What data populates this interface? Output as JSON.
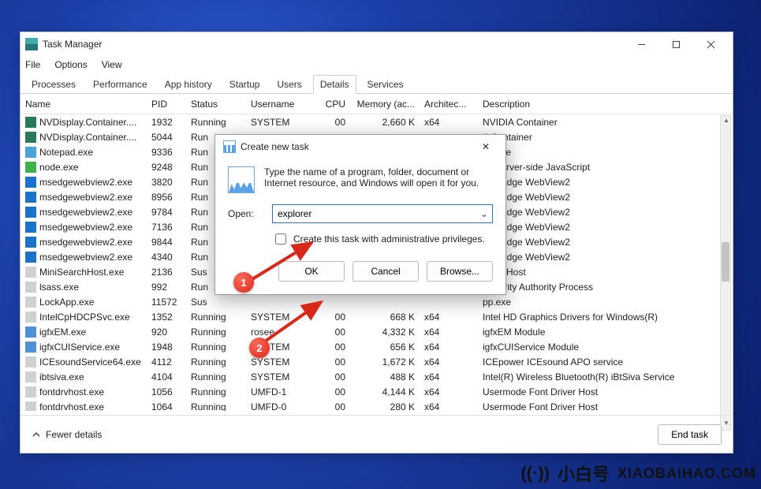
{
  "window": {
    "title": "Task Manager",
    "menus": [
      "File",
      "Options",
      "View"
    ],
    "tabs": [
      "Processes",
      "Performance",
      "App history",
      "Startup",
      "Users",
      "Details",
      "Services"
    ],
    "selected_tab": 5,
    "columns": [
      "Name",
      "PID",
      "Status",
      "Username",
      "CPU",
      "Memory (ac...",
      "Architec...",
      "Description"
    ],
    "fewer": "Fewer details",
    "end_task": "End task"
  },
  "rows": [
    {
      "ico": "#2a7a5a",
      "name": "NVDisplay.Container....",
      "pid": "1932",
      "status": "Running",
      "user": "SYSTEM",
      "cpu": "00",
      "mem": "2,660 K",
      "arch": "x64",
      "desc": "NVIDIA Container"
    },
    {
      "ico": "#2a7a5a",
      "name": "NVDisplay.Container....",
      "pid": "5044",
      "status": "Run",
      "user": "",
      "cpu": "",
      "mem": "",
      "arch": "",
      "desc": "A Container"
    },
    {
      "ico": "#4aa3d6",
      "name": "Notepad.exe",
      "pid": "9336",
      "status": "Run",
      "user": "",
      "cpu": "",
      "mem": "",
      "arch": "",
      "desc": "ad.exe"
    },
    {
      "ico": "#3cb24a",
      "name": "node.exe",
      "pid": "9248",
      "status": "Run",
      "user": "",
      "cpu": "",
      "mem": "",
      "arch": "",
      "desc": "js: Server-side JavaScript"
    },
    {
      "ico": "#1a73c9",
      "name": "msedgewebview2.exe",
      "pid": "3820",
      "status": "Run",
      "user": "",
      "cpu": "",
      "mem": "",
      "arch": "",
      "desc": "soft Edge WebView2"
    },
    {
      "ico": "#1a73c9",
      "name": "msedgewebview2.exe",
      "pid": "8956",
      "status": "Run",
      "user": "",
      "cpu": "",
      "mem": "",
      "arch": "",
      "desc": "soft Edge WebView2"
    },
    {
      "ico": "#1a73c9",
      "name": "msedgewebview2.exe",
      "pid": "9784",
      "status": "Run",
      "user": "",
      "cpu": "",
      "mem": "",
      "arch": "",
      "desc": "soft Edge WebView2"
    },
    {
      "ico": "#1a73c9",
      "name": "msedgewebview2.exe",
      "pid": "7136",
      "status": "Run",
      "user": "",
      "cpu": "",
      "mem": "",
      "arch": "",
      "desc": "soft Edge WebView2"
    },
    {
      "ico": "#1a73c9",
      "name": "msedgewebview2.exe",
      "pid": "9844",
      "status": "Run",
      "user": "",
      "cpu": "",
      "mem": "",
      "arch": "",
      "desc": "soft Edge WebView2"
    },
    {
      "ico": "#1a73c9",
      "name": "msedgewebview2.exe",
      "pid": "4340",
      "status": "Run",
      "user": "",
      "cpu": "",
      "mem": "",
      "arch": "",
      "desc": "soft Edge WebView2"
    },
    {
      "ico": "#d0d0d0",
      "name": "MiniSearchHost.exe",
      "pid": "2136",
      "status": "Sus",
      "user": "",
      "cpu": "",
      "mem": "",
      "arch": "",
      "desc": "earchHost"
    },
    {
      "ico": "#d0d0d0",
      "name": "lsass.exe",
      "pid": "992",
      "status": "Run",
      "user": "",
      "cpu": "",
      "mem": "",
      "arch": "",
      "desc": "Security Authority Process"
    },
    {
      "ico": "#d0d0d0",
      "name": "LockApp.exe",
      "pid": "11572",
      "status": "Sus",
      "user": "",
      "cpu": "",
      "mem": "",
      "arch": "",
      "desc": "pp.exe"
    },
    {
      "ico": "#d0d0d0",
      "name": "IntelCpHDCPSvc.exe",
      "pid": "1352",
      "status": "Running",
      "user": "SYSTEM",
      "cpu": "00",
      "mem": "668 K",
      "arch": "x64",
      "desc": "Intel HD Graphics Drivers for Windows(R)"
    },
    {
      "ico": "#4f90d6",
      "name": "igfxEM.exe",
      "pid": "920",
      "status": "Running",
      "user": "rosee",
      "cpu": "00",
      "mem": "4,332 K",
      "arch": "x64",
      "desc": "igfxEM Module"
    },
    {
      "ico": "#4f90d6",
      "name": "igfxCUIService.exe",
      "pid": "1948",
      "status": "Running",
      "user": "SYSTEM",
      "cpu": "00",
      "mem": "656 K",
      "arch": "x64",
      "desc": "igfxCUIService Module"
    },
    {
      "ico": "#d0d0d0",
      "name": "ICEsoundService64.exe",
      "pid": "4112",
      "status": "Running",
      "user": "SYSTEM",
      "cpu": "00",
      "mem": "1,672 K",
      "arch": "x64",
      "desc": "ICEpower ICEsound APO service"
    },
    {
      "ico": "#d0d0d0",
      "name": "ibtsiva.exe",
      "pid": "4104",
      "status": "Running",
      "user": "SYSTEM",
      "cpu": "00",
      "mem": "488 K",
      "arch": "x64",
      "desc": "Intel(R) Wireless Bluetooth(R) iBtSiva Service"
    },
    {
      "ico": "#d0d0d0",
      "name": "fontdrvhost.exe",
      "pid": "1056",
      "status": "Running",
      "user": "UMFD-1",
      "cpu": "00",
      "mem": "4,144 K",
      "arch": "x64",
      "desc": "Usermode Font Driver Host"
    },
    {
      "ico": "#d0d0d0",
      "name": "fontdrvhost.exe",
      "pid": "1064",
      "status": "Running",
      "user": "UMFD-0",
      "cpu": "00",
      "mem": "280 K",
      "arch": "x64",
      "desc": "Usermode Font Driver Host"
    }
  ],
  "dialog": {
    "title": "Create new task",
    "message": "Type the name of a program, folder, document or Internet resource, and Windows will open it for you.",
    "open_label": "Open:",
    "open_value": "explorer",
    "admin_checkbox": "Create this task with administrative privileges.",
    "ok": "OK",
    "cancel": "Cancel",
    "browse": "Browse..."
  },
  "callouts": {
    "one": "1",
    "two": "2"
  },
  "brand": {
    "cn": "小白号",
    "en": "XIAOBAIHAO.COM"
  }
}
